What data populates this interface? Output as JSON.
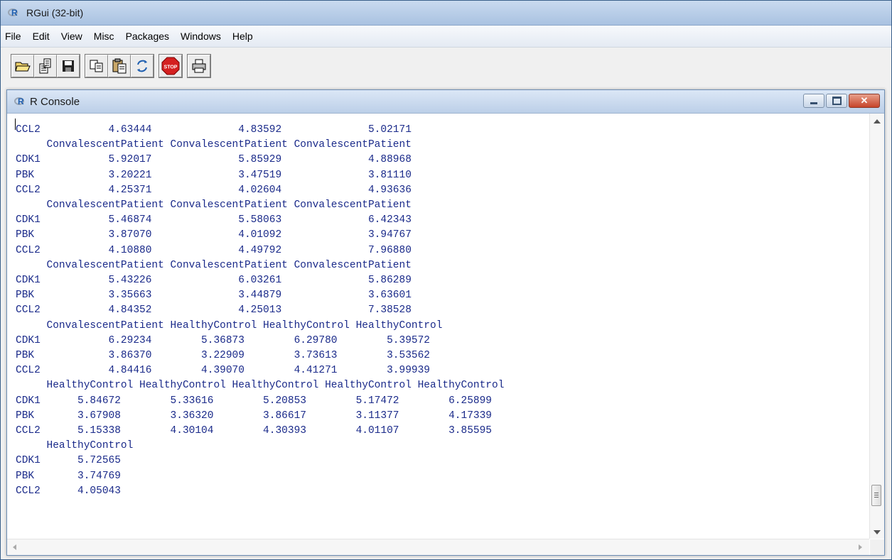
{
  "app": {
    "title": "RGui (32-bit)"
  },
  "menu": [
    "File",
    "Edit",
    "View",
    "Misc",
    "Packages",
    "Windows",
    "Help"
  ],
  "toolbar": {
    "buttons": [
      "open-script",
      "load-workspace",
      "save-workspace",
      "copy",
      "paste",
      "copy-and-paste",
      "stop",
      "print"
    ],
    "stop_label": "STOP"
  },
  "console": {
    "title": "R Console",
    "output_lines": [
      "CCL2           4.63444              4.83592              5.02171",
      "     ConvalescentPatient ConvalescentPatient ConvalescentPatient",
      "CDK1           5.92017              5.85929              4.88968",
      "PBK            3.20221              3.47519              3.81110",
      "CCL2           4.25371              4.02604              4.93636",
      "     ConvalescentPatient ConvalescentPatient ConvalescentPatient",
      "CDK1           5.46874              5.58063              6.42343",
      "PBK            3.87070              4.01092              3.94767",
      "CCL2           4.10880              4.49792              7.96880",
      "     ConvalescentPatient ConvalescentPatient ConvalescentPatient",
      "CDK1           5.43226              6.03261              5.86289",
      "PBK            3.35663              3.44879              3.63601",
      "CCL2           4.84352              4.25013              7.38528",
      "     ConvalescentPatient HealthyControl HealthyControl HealthyControl",
      "CDK1           6.29234        5.36873        6.29780        5.39572",
      "PBK            3.86370        3.22909        3.73613        3.53562",
      "CCL2           4.84416        4.39070        4.41271        3.99939",
      "     HealthyControl HealthyControl HealthyControl HealthyControl HealthyControl",
      "CDK1      5.84672        5.33616        5.20853        5.17472        6.25899",
      "PBK       3.67908        3.36320        3.86617        3.11377        4.17339",
      "CCL2      5.15338        4.30104        4.30393        4.01107        3.85595",
      "     HealthyControl",
      "CDK1      5.72565",
      "PBK       3.74769",
      "CCL2      4.05043"
    ]
  },
  "colors": {
    "console_text": "#1a2a8a",
    "r_blue": "#1f5fb0",
    "stop_red": "#d42020"
  }
}
